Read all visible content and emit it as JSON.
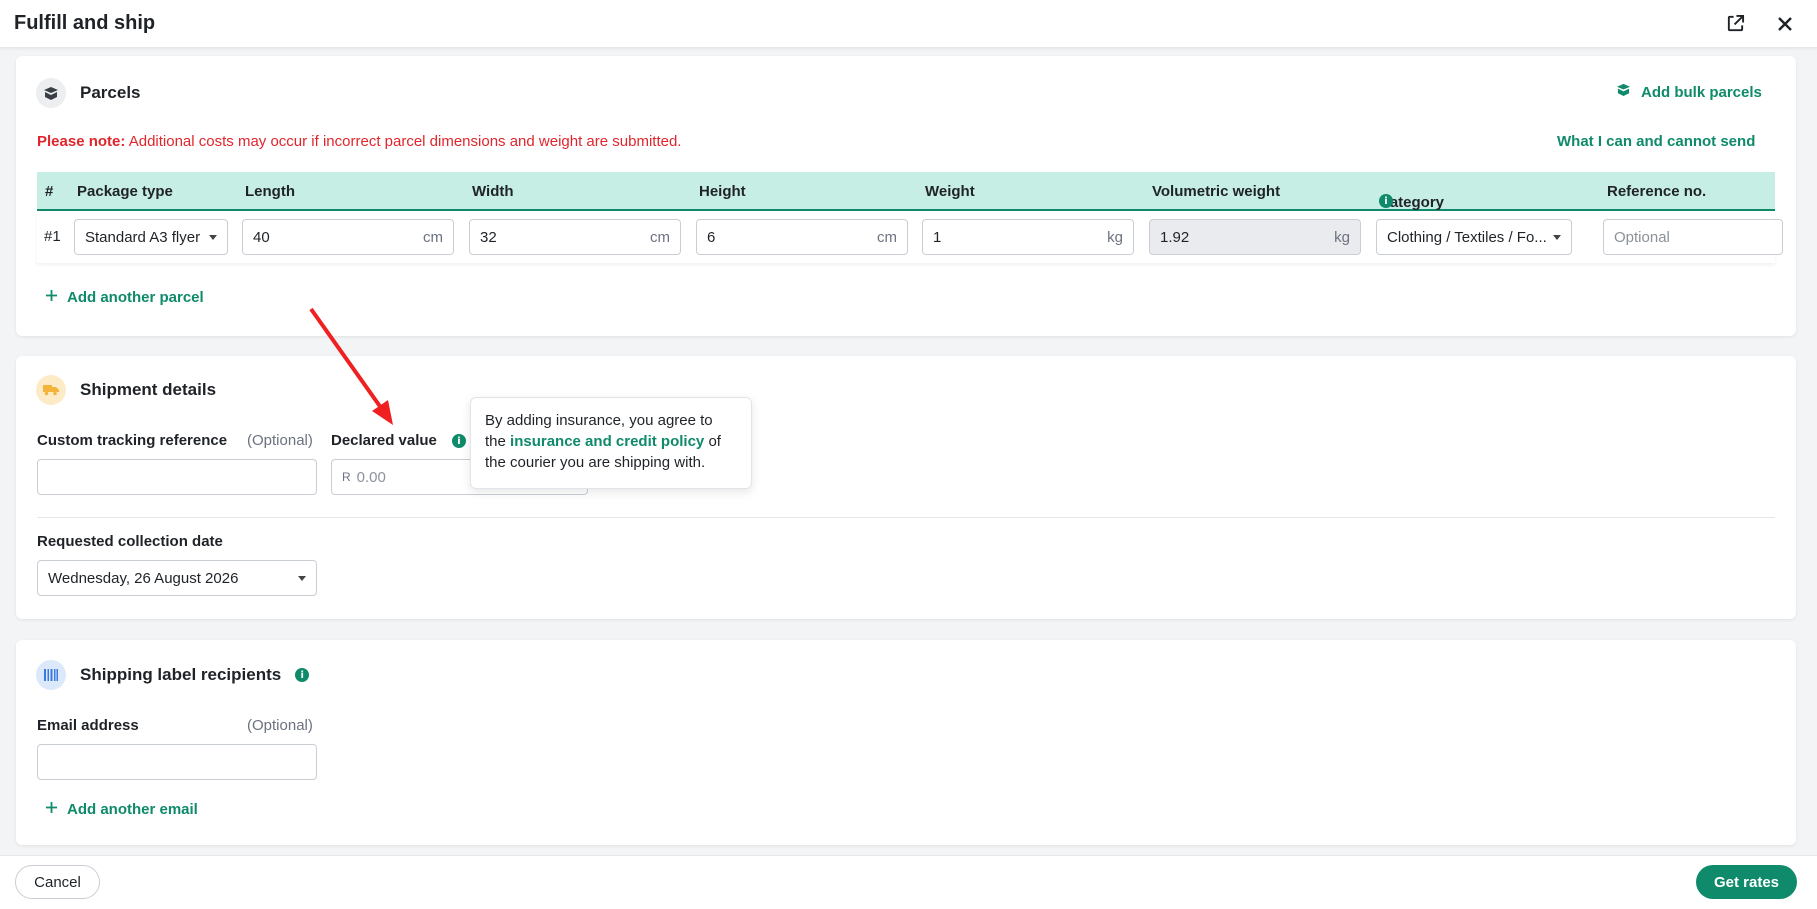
{
  "header": {
    "title": "Fulfill and ship"
  },
  "colors": {
    "accent": "#0f8a6a",
    "warning": "#e0262d",
    "table_header": "#c7eee5"
  },
  "parcels": {
    "title": "Parcels",
    "add_bulk": "Add bulk parcels",
    "note_label": "Please note:",
    "note_text": "Additional costs may occur if incorrect parcel dimensions and weight are submitted.",
    "what_link": "What I can and cannot send",
    "columns": [
      "#",
      "Package type",
      "Length",
      "Width",
      "Height",
      "Weight",
      "Volumetric weight",
      "Category",
      "Reference no."
    ],
    "row": {
      "index": "#1",
      "package_type": "Standard A3 flyer",
      "length": "40",
      "length_unit": "cm",
      "width": "32",
      "width_unit": "cm",
      "height": "6",
      "height_unit": "cm",
      "weight": "1",
      "weight_unit": "kg",
      "volumetric": "1.92",
      "volumetric_unit": "kg",
      "category": "Clothing / Textiles / Fo...",
      "reference_placeholder": "Optional"
    },
    "add_another": "Add another parcel"
  },
  "shipment": {
    "title": "Shipment details",
    "tracking_label": "Custom tracking reference",
    "tracking_optional": "(Optional)",
    "declared_label": "Declared value",
    "declared_currency": "R",
    "declared_placeholder": "0.00",
    "collection_label": "Requested collection date",
    "collection_value": "Wednesday, 26 August 2026"
  },
  "tooltip": {
    "text_before": "By adding insurance, you agree to the",
    "link": "insurance and credit policy",
    "text_after": "of the courier you are shipping with."
  },
  "labels": {
    "title": "Shipping label recipients",
    "email_label": "Email address",
    "email_optional": "(Optional)",
    "add_email": "Add another email"
  },
  "footer": {
    "cancel": "Cancel",
    "get_rates": "Get rates"
  }
}
